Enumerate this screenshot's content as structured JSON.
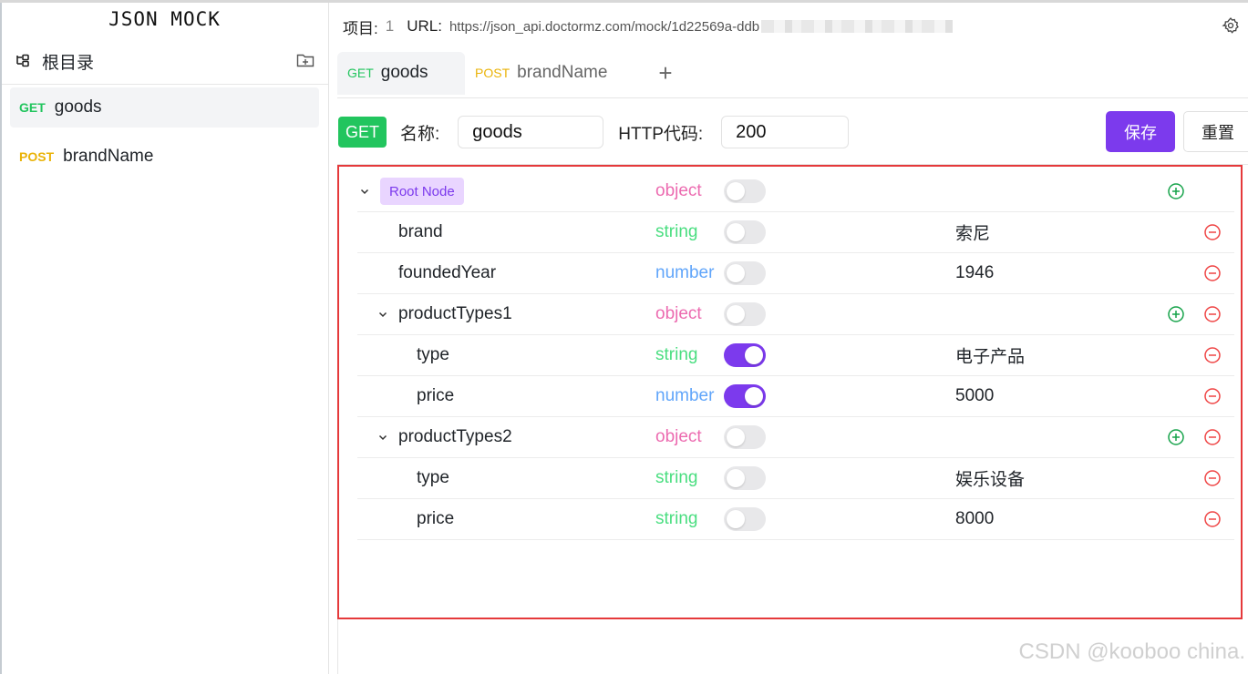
{
  "app": {
    "title": "JSON MOCK"
  },
  "sidebar": {
    "root_label": "根目录",
    "items": [
      {
        "method": "GET",
        "name": "goods"
      },
      {
        "method": "POST",
        "name": "brandName"
      }
    ]
  },
  "header": {
    "project_label": "项目:",
    "project_value": "1",
    "url_label": "URL:",
    "url_value": "https://json_api.doctormz.com/mock/1d22569a-ddb"
  },
  "tabs": [
    {
      "method": "GET",
      "name": "goods"
    },
    {
      "method": "POST",
      "name": "brandName"
    }
  ],
  "tab_add": "+",
  "form": {
    "method": "GET",
    "name_label": "名称:",
    "name_value": "goods",
    "code_label": "HTTP代码:",
    "code_value": "200",
    "save_label": "保存",
    "reset_label": "重置"
  },
  "tree": {
    "root_label": "Root Node",
    "rows": [
      {
        "key": "",
        "type": "object",
        "on": false,
        "value": "",
        "depth": 0
      },
      {
        "key": "brand",
        "type": "string",
        "on": false,
        "value": "索尼",
        "depth": 1
      },
      {
        "key": "foundedYear",
        "type": "number",
        "on": false,
        "value": "1946",
        "depth": 1
      },
      {
        "key": "productTypes1",
        "type": "object",
        "on": false,
        "value": "",
        "depth": 1
      },
      {
        "key": "type",
        "type": "string",
        "on": true,
        "value": "电子产品",
        "depth": 2
      },
      {
        "key": "price",
        "type": "number",
        "on": true,
        "value": "5000",
        "depth": 2
      },
      {
        "key": "productTypes2",
        "type": "object",
        "on": false,
        "value": "",
        "depth": 1
      },
      {
        "key": "type",
        "type": "string",
        "on": false,
        "value": "娱乐设备",
        "depth": 2
      },
      {
        "key": "price",
        "type": "string",
        "on": false,
        "value": "8000",
        "depth": 2
      }
    ]
  },
  "watermark": "CSDN @kooboo china.",
  "colors": {
    "accent": "#7c3aed",
    "get": "#22c55e",
    "post": "#eab308",
    "object_type": "#ec6bb0",
    "string_type": "#4ade80",
    "number_type": "#60a5fa",
    "highlight_frame": "#e5393b"
  },
  "icons": {
    "tree": "tree-structure-icon",
    "folder_add": "folder-add-icon",
    "settings": "gear-icon",
    "expand": "chevron-down-icon",
    "add": "plus-circle-icon",
    "remove": "minus-circle-icon"
  }
}
